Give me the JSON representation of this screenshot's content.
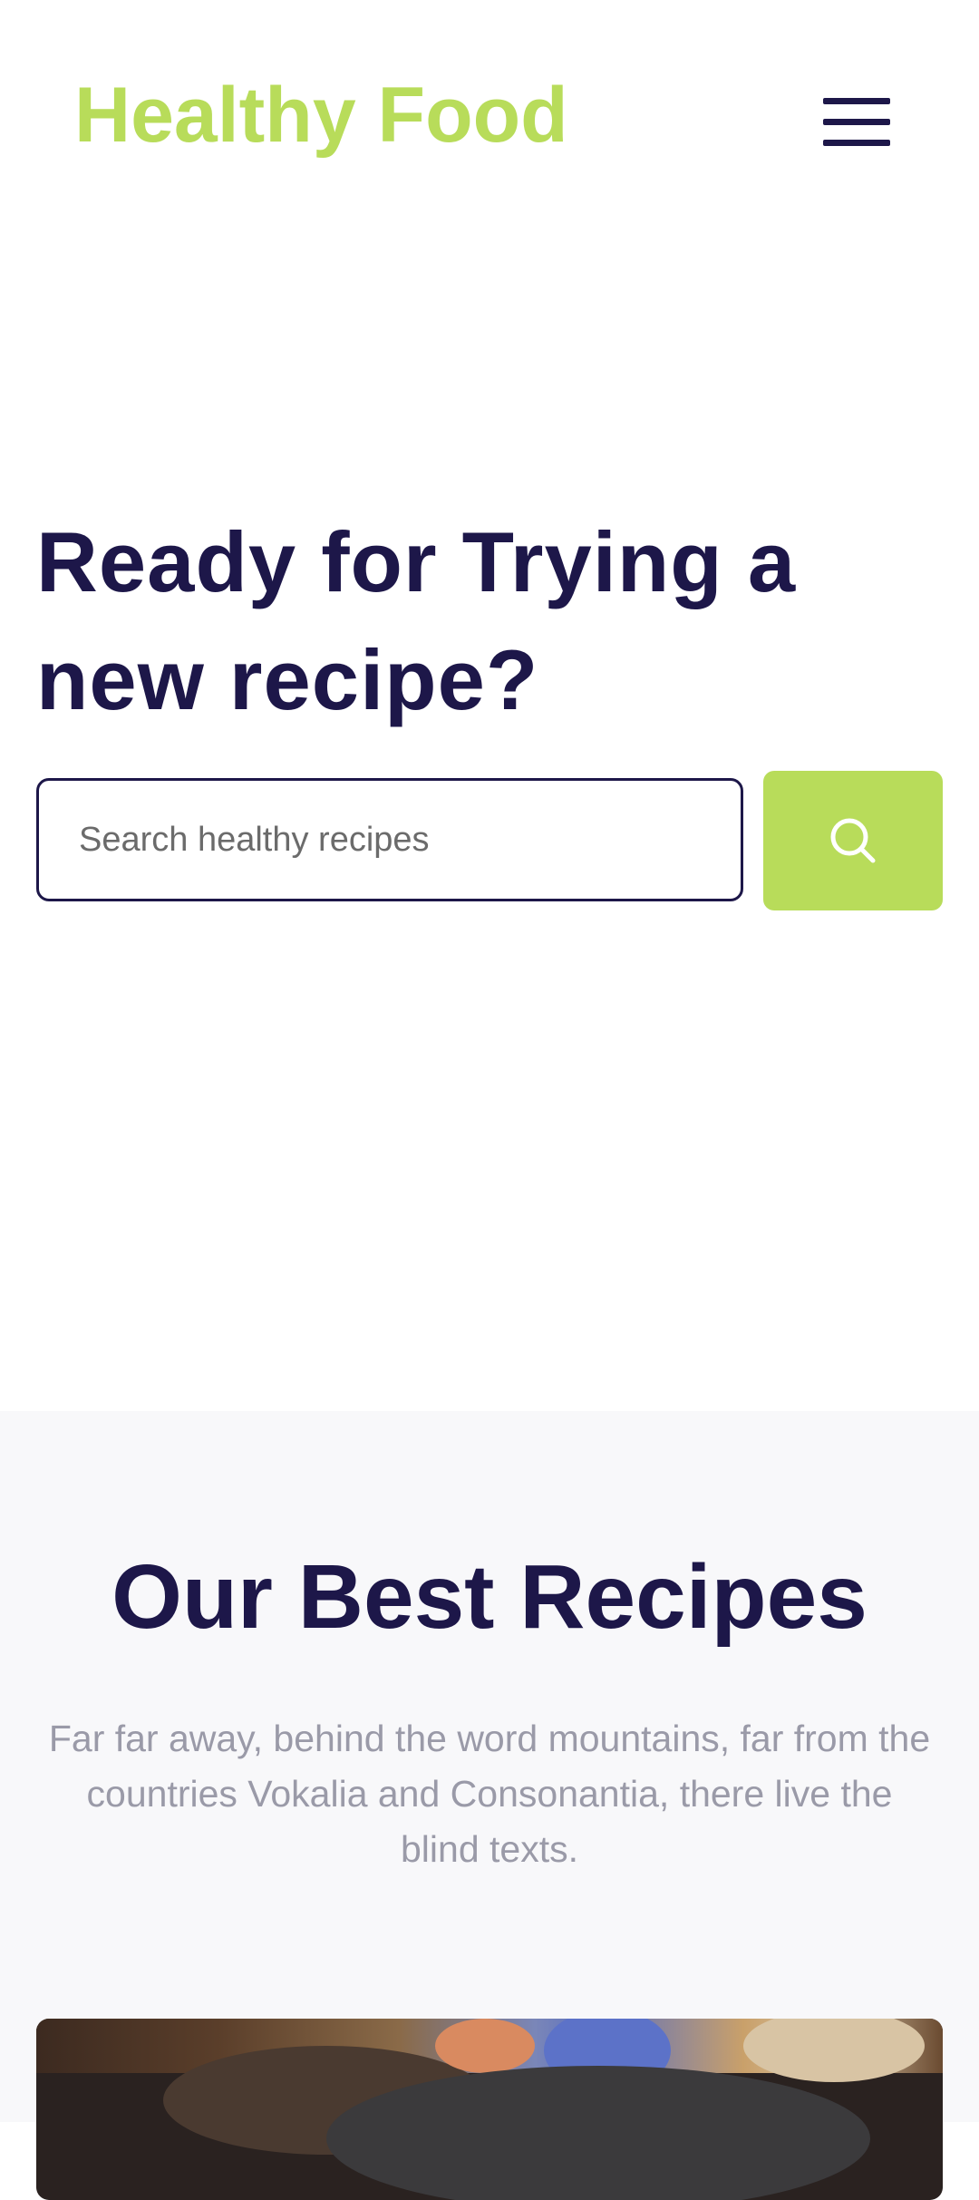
{
  "header": {
    "logo": "Healthy Food"
  },
  "hero": {
    "title": "Ready for Trying a new recipe?",
    "search_placeholder": "Search healthy recipes"
  },
  "recipes": {
    "title": "Our Best Recipes",
    "description": "Far far away, behind the word mountains, far from the countries Vokalia and Consonantia, there live the blind texts."
  },
  "colors": {
    "brand": "#b8dc5a",
    "primary_text": "#1d1749",
    "muted_text": "#9a9aa8",
    "section_bg": "#f8f8fa"
  },
  "icons": {
    "menu": "hamburger-menu-icon",
    "search": "search-icon"
  }
}
